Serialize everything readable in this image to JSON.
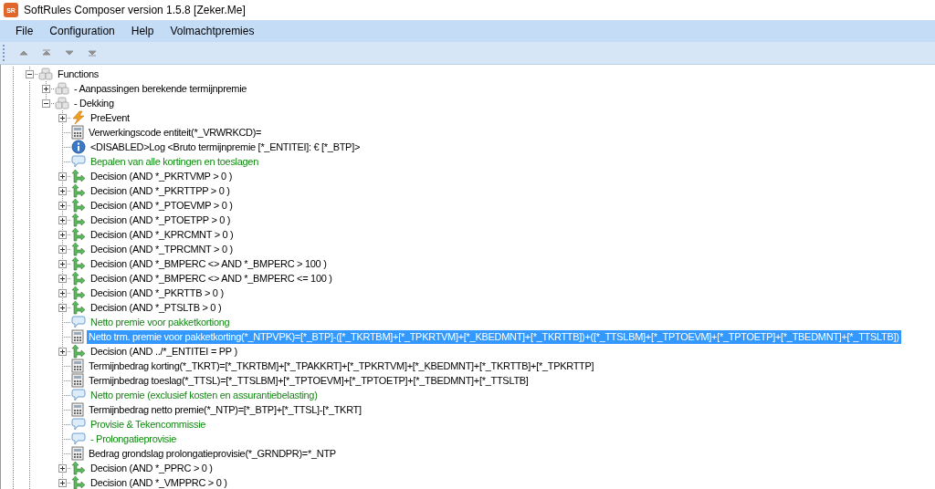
{
  "window": {
    "title": "SoftRules Composer version 1.5.8 [Zeker.Me]",
    "app_icon": "SR"
  },
  "menu": [
    {
      "label": "File"
    },
    {
      "label": "Configuration"
    },
    {
      "label": "Help"
    },
    {
      "label": "Volmachtpremies"
    }
  ],
  "toolbar": [
    {
      "kind": "up"
    },
    {
      "kind": "top"
    },
    {
      "kind": "down"
    },
    {
      "kind": "bottom"
    }
  ],
  "tree": [
    {
      "kind": "module",
      "label": "Functions",
      "expanded": true,
      "selected": false,
      "children": [
        {
          "kind": "module",
          "label": "- Aanpassingen berekende termijnpremie",
          "expanded": false,
          "selected": false
        },
        {
          "kind": "module",
          "label": "- Dekking",
          "expanded": true,
          "selected": false,
          "children": [
            {
              "kind": "event",
              "label": "PreEvent",
              "expanded": false,
              "selected": false
            },
            {
              "kind": "calc",
              "label": "Verwerkingscode entiteit(*_VRWRKCD)=",
              "selected": false
            },
            {
              "kind": "info",
              "label": "<DISABLED>Log <Bruto termijnpremie [*_ENTITEI]: € [*_BTP]>",
              "selected": false
            },
            {
              "kind": "comment",
              "label": "Bepalen van alle kortingen en toeslagen",
              "selected": false
            },
            {
              "kind": "decision",
              "label": "Decision (AND *_PKRTVMP > 0 )",
              "expanded": false,
              "selected": false
            },
            {
              "kind": "decision",
              "label": "Decision (AND *_PKRTTPP > 0 )",
              "expanded": false,
              "selected": false
            },
            {
              "kind": "decision",
              "label": "Decision (AND *_PTOEVMP > 0 )",
              "expanded": false,
              "selected": false
            },
            {
              "kind": "decision",
              "label": "Decision (AND *_PTOETPP > 0 )",
              "expanded": false,
              "selected": false
            },
            {
              "kind": "decision",
              "label": "Decision (AND *_KPRCMNT > 0 )",
              "expanded": false,
              "selected": false
            },
            {
              "kind": "decision",
              "label": "Decision (AND *_TPRCMNT > 0 )",
              "expanded": false,
              "selected": false
            },
            {
              "kind": "decision",
              "label": "Decision (AND *_BMPERC <>   AND *_BMPERC > 100 )",
              "expanded": false,
              "selected": false
            },
            {
              "kind": "decision",
              "label": "Decision (AND *_BMPERC <>   AND *_BMPERC <= 100 )",
              "expanded": false,
              "selected": false
            },
            {
              "kind": "decision",
              "label": "Decision (AND *_PKRTTB > 0 )",
              "expanded": false,
              "selected": false
            },
            {
              "kind": "decision",
              "label": "Decision (AND *_PTSLTB > 0 )",
              "expanded": false,
              "selected": false
            },
            {
              "kind": "comment",
              "label": "Netto premie voor pakketkortiong",
              "selected": false
            },
            {
              "kind": "calc",
              "label": "Netto trm. premie voor pakketkorting(*_NTPVPK)=[*_BTP]-([*_TKRTBM]+[*_TPKRTVM]+[*_KBEDMNT]+[*_TKRTTB])+([*_TTSLBM]+[*_TPTOEVM]+[*_TPTOETP]+[*_TBEDMNT]+[*_TTSLTB])",
              "selected": true
            },
            {
              "kind": "decision",
              "label": "Decision (AND ../*_ENTITEI = PP )",
              "expanded": false,
              "selected": false
            },
            {
              "kind": "calc",
              "label": "Termijnbedrag korting(*_TKRT)=[*_TKRTBM]+[*_TPAKKRT]+[*_TPKRTVM]+[*_KBEDMNT]+[*_TKRTTB]+[*_TPKRTTP]",
              "selected": false
            },
            {
              "kind": "calc",
              "label": "Termijnbedrag toeslag(*_TTSL)=[*_TTSLBM]+[*_TPTOEVM]+[*_TPTOETP]+[*_TBEDMNT]+[*_TTSLTB]",
              "selected": false
            },
            {
              "kind": "comment",
              "label": "Netto premie (exclusief kosten en assurantiebelasting)",
              "selected": false
            },
            {
              "kind": "calc",
              "label": "Termijnbedrag netto premie(*_NTP)=[*_BTP]+[*_TTSL]-[*_TKRT]",
              "selected": false
            },
            {
              "kind": "comment",
              "label": "Provisie & Tekencommissie",
              "selected": false
            },
            {
              "kind": "comment",
              "label": "- Prolongatieprovisie",
              "selected": false
            },
            {
              "kind": "calc",
              "label": "Bedrag grondslag prolongatieprovisie(*_GRNDPR)=*_NTP",
              "selected": false
            },
            {
              "kind": "decision",
              "label": "Decision (AND *_PPRC > 0 )",
              "expanded": false,
              "selected": false
            },
            {
              "kind": "decision",
              "label": "Decision (AND *_VMPPRC > 0 )",
              "expanded": false,
              "selected": false
            }
          ]
        }
      ]
    }
  ]
}
